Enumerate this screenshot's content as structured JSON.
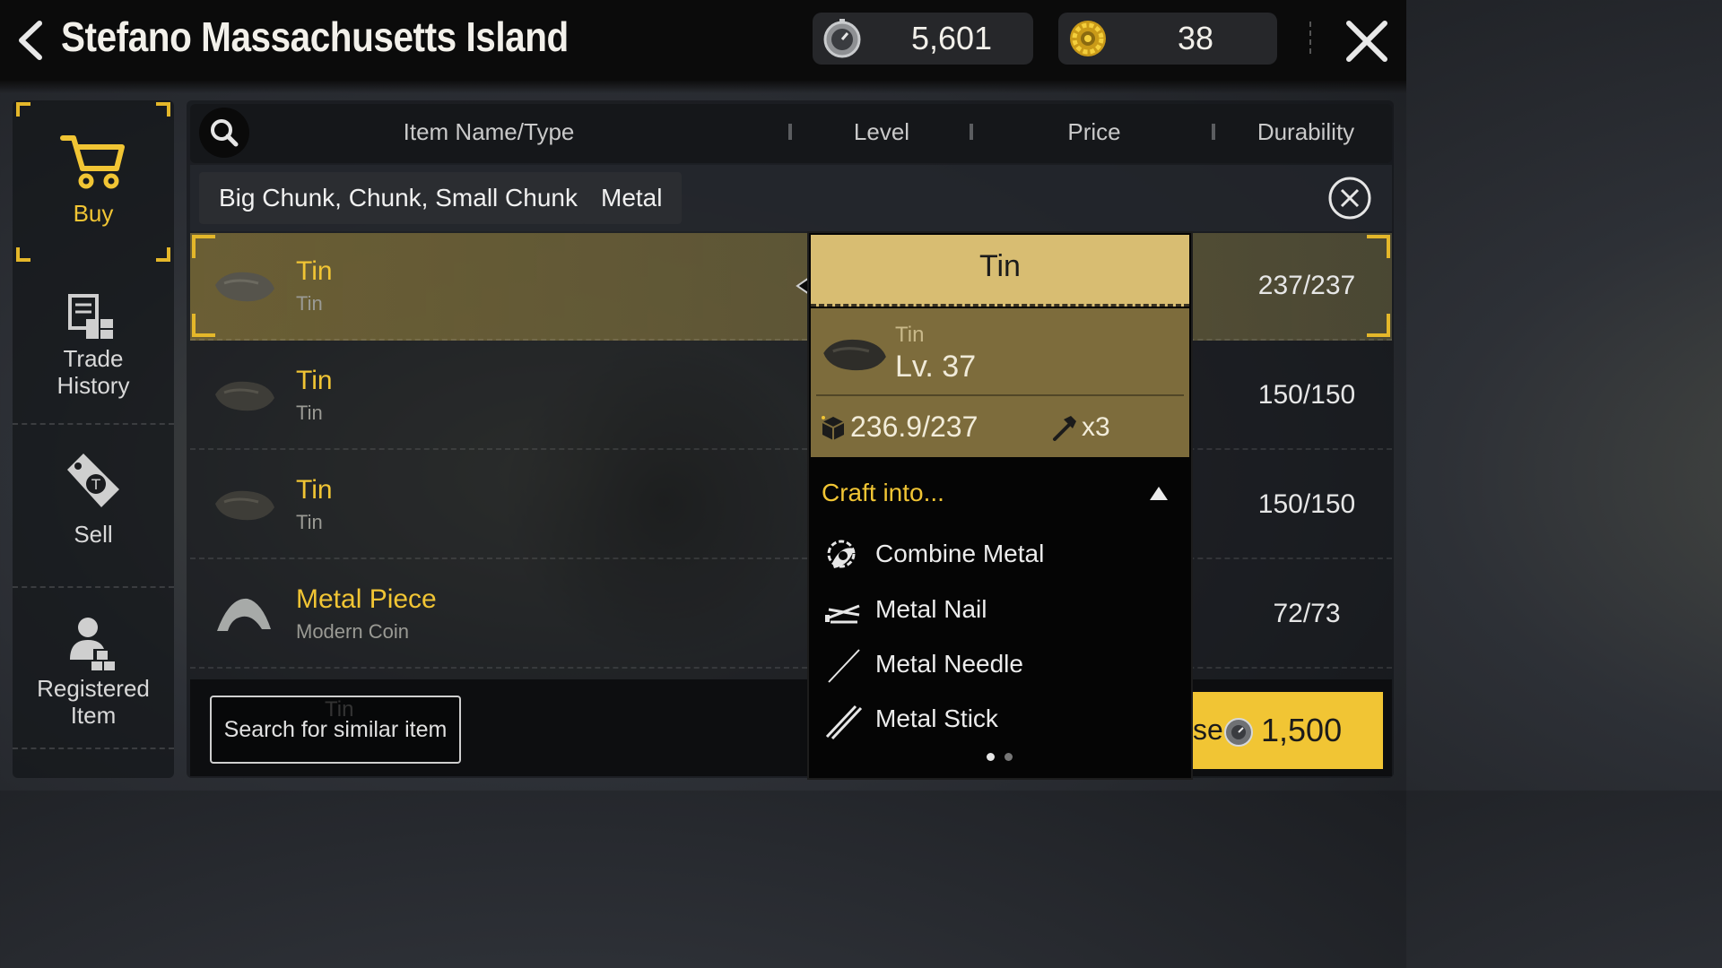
{
  "header": {
    "title": "Stefano Massachusetts Island",
    "currency_primary": "5,601",
    "currency_secondary": "38"
  },
  "nav": {
    "buy": "Buy",
    "trade_history_line1": "Trade",
    "trade_history_line2": "History",
    "sell": "Sell",
    "registered_line1": "Registered",
    "registered_line2": "Item"
  },
  "table": {
    "col_name": "Item Name/Type",
    "col_level": "Level",
    "col_price": "Price",
    "col_durability": "Durability"
  },
  "filters": {
    "size_chip": "Big Chunk, Chunk, Small Chunk",
    "type_chip": "Metal"
  },
  "rows": [
    {
      "name": "Tin",
      "sub": "Tin",
      "durability": "237/237"
    },
    {
      "name": "Tin",
      "sub": "Tin",
      "durability": "150/150"
    },
    {
      "name": "Tin",
      "sub": "Tin",
      "durability": "150/150"
    },
    {
      "name": "Metal Piece",
      "sub": "Modern Coin",
      "durability": "72/73"
    }
  ],
  "bottom": {
    "ghost_name": "Tin",
    "search_similar": "Search for similar item",
    "buy_partial": "se",
    "buy_amount": "1,500"
  },
  "tooltip": {
    "title": "Tin",
    "type": "Tin",
    "level": "Lv. 37",
    "durability": "236.9/237",
    "craft_count": "x3",
    "craft_label": "Craft into...",
    "craft_items": [
      "Combine Metal",
      "Metal Nail",
      "Metal Needle",
      "Metal Stick"
    ]
  },
  "colors": {
    "accent": "#f1c534",
    "selected_row": "#786937",
    "tooltip_head": "#d8bd72",
    "tooltip_body": "#7d6c3c"
  },
  "icons": {
    "back": "chevron-left-icon",
    "primary_currency": "stopwatch-coin-icon",
    "secondary_currency": "gear-coin-icon",
    "close": "close-icon",
    "search": "search-icon",
    "buy": "cart-icon",
    "trade_history": "ledger-icon",
    "sell": "price-tag-icon",
    "registered": "user-crates-icon"
  }
}
